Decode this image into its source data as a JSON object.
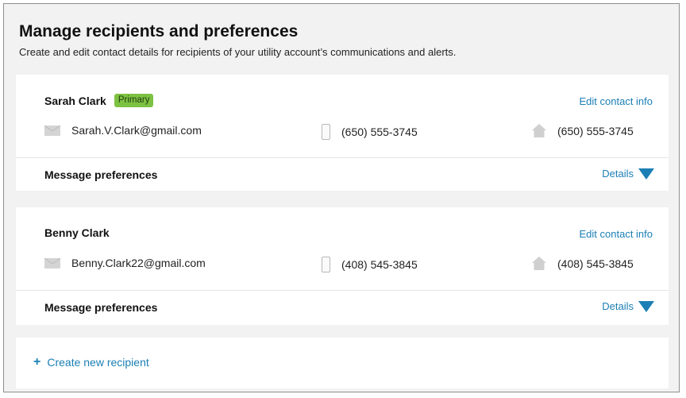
{
  "header": {
    "title": "Manage recipients and preferences",
    "subtitle": "Create and edit contact details for recipients of your utility account’s communications and alerts."
  },
  "recipients": [
    {
      "name": "Sarah Clark",
      "badge": "Primary",
      "edit_label": "Edit contact info",
      "email": "Sarah.V.Clark@gmail.com",
      "mobile": "(650) 555-3745",
      "home": "(650) 555-3745",
      "pref_label": "Message preferences",
      "details_label": "Details"
    },
    {
      "name": "Benny Clark",
      "edit_label": "Edit contact info",
      "email": "Benny.Clark22@gmail.com",
      "mobile": "(408) 545-3845",
      "home": "(408) 545-3845",
      "pref_label": "Message preferences",
      "details_label": "Details"
    }
  ],
  "create": {
    "label": "Create new recipient",
    "icon": "plus-icon"
  },
  "icons": {
    "email": "envelope-icon",
    "mobile": "mobile-phone-icon",
    "home": "house-icon",
    "expand": "triangle-down-icon"
  },
  "colors": {
    "link": "#1b7fb5",
    "badge_bg": "#7dc242",
    "background": "#f2f2f2",
    "card": "#ffffff"
  }
}
